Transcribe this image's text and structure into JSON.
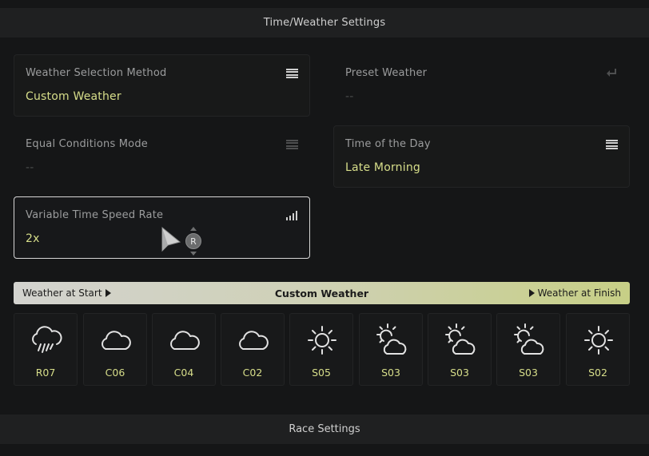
{
  "header": {
    "title": "Time/Weather Settings"
  },
  "footer": {
    "title": "Race Settings"
  },
  "settings": {
    "weather_selection_method": {
      "label": "Weather Selection Method",
      "value": "Custom Weather",
      "icon": "menu-icon"
    },
    "preset_weather": {
      "label": "Preset Weather",
      "value": "--",
      "icon": "return-icon"
    },
    "equal_conditions_mode": {
      "label": "Equal Conditions Mode",
      "value": "--",
      "icon": "menu-icon"
    },
    "time_of_day": {
      "label": "Time of the Day",
      "value": "Late Morning",
      "icon": "menu-icon"
    },
    "variable_time_speed_rate": {
      "label": "Variable Time Speed Rate",
      "value": "2x",
      "icon": "signal-bars-icon"
    }
  },
  "controls": {
    "r_button": "R"
  },
  "weather_bar": {
    "start_label": "Weather at Start",
    "title": "Custom Weather",
    "finish_label": "Weather at Finish"
  },
  "weather_slots": [
    {
      "code": "R07",
      "icon": "rain-cloud-icon"
    },
    {
      "code": "C06",
      "icon": "cloud-icon"
    },
    {
      "code": "C04",
      "icon": "cloud-icon"
    },
    {
      "code": "C02",
      "icon": "cloud-icon"
    },
    {
      "code": "S05",
      "icon": "sun-icon"
    },
    {
      "code": "S03",
      "icon": "sun-cloud-icon"
    },
    {
      "code": "S03",
      "icon": "sun-cloud-icon"
    },
    {
      "code": "S03",
      "icon": "sun-cloud-icon"
    },
    {
      "code": "S02",
      "icon": "sun-icon"
    }
  ],
  "colors": {
    "accent_value": "#d7de8a",
    "label": "#9b9c9d",
    "background": "#151617",
    "bar_start": "#d3d3cf",
    "bar_end": "#c7cf86"
  }
}
